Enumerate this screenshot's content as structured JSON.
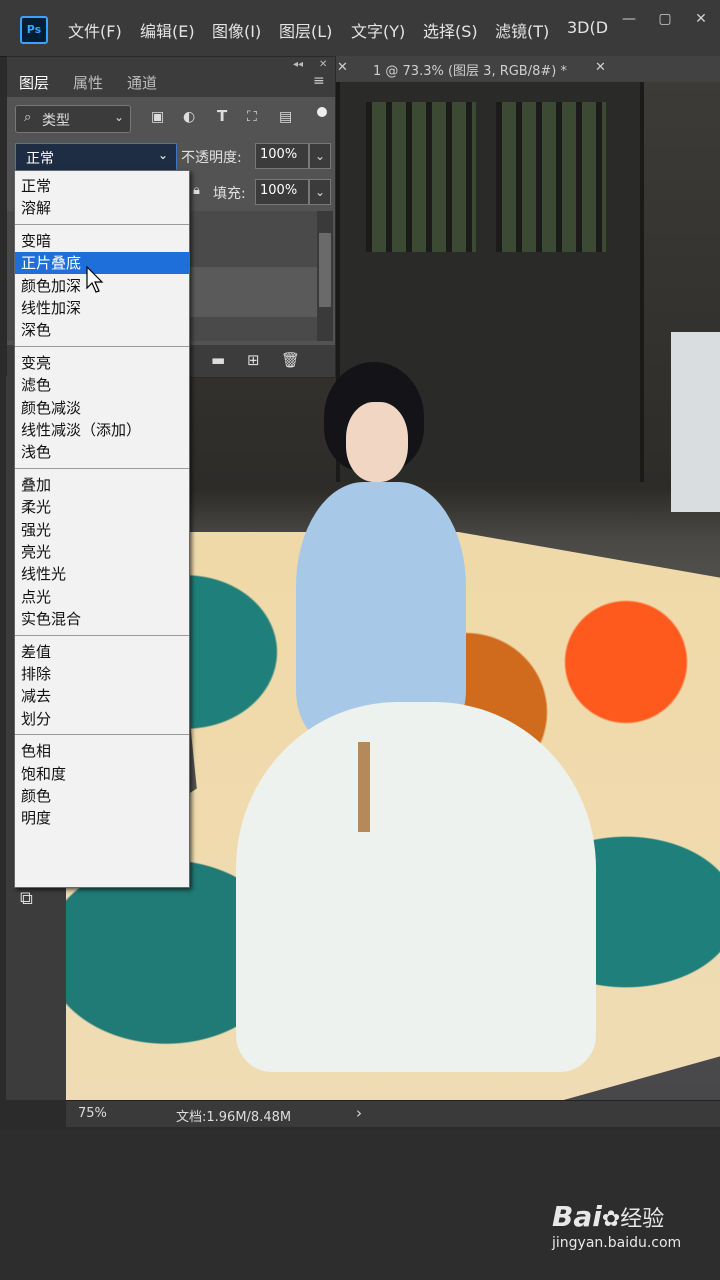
{
  "menubar": {
    "items": [
      "文件(F)",
      "编辑(E)",
      "图像(I)",
      "图层(L)",
      "文字(Y)",
      "选择(S)",
      "滤镜(T)",
      "3D(D"
    ],
    "window_buttons": [
      "—",
      "▢",
      "✕"
    ]
  },
  "document_tab": {
    "title": "1 @ 73.3% (图层 3, RGB/8#) *"
  },
  "layers_panel": {
    "tabs": [
      "图层",
      "属性",
      "通道"
    ],
    "filter_kind": "类型",
    "blend_mode": "正常",
    "opacity_label": "不透明度:",
    "opacity_value": "100%",
    "fill_label": "填充:",
    "fill_value": "100%"
  },
  "blend_modes": {
    "groups": [
      [
        "正常",
        "溶解"
      ],
      [
        "变暗",
        "正片叠底",
        "颜色加深",
        "线性加深",
        "深色"
      ],
      [
        "变亮",
        "滤色",
        "颜色减淡",
        "线性减淡（添加）",
        "浅色"
      ],
      [
        "叠加",
        "柔光",
        "强光",
        "亮光",
        "线性光",
        "点光",
        "实色混合"
      ],
      [
        "差值",
        "排除",
        "减去",
        "划分"
      ],
      [
        "色相",
        "饱和度",
        "颜色",
        "明度"
      ]
    ],
    "selected": "正片叠底"
  },
  "status_bar": {
    "zoom": "75%",
    "doc_info": "文档:1.96M/8.48M",
    "arrow": "›"
  },
  "watermark": {
    "brand": "Bai",
    "brand_suffix": "经验",
    "url": "jingyan.baidu.com"
  },
  "colors": {
    "accent": "#1e6fd9",
    "ps_blue": "#3aa3ff"
  }
}
